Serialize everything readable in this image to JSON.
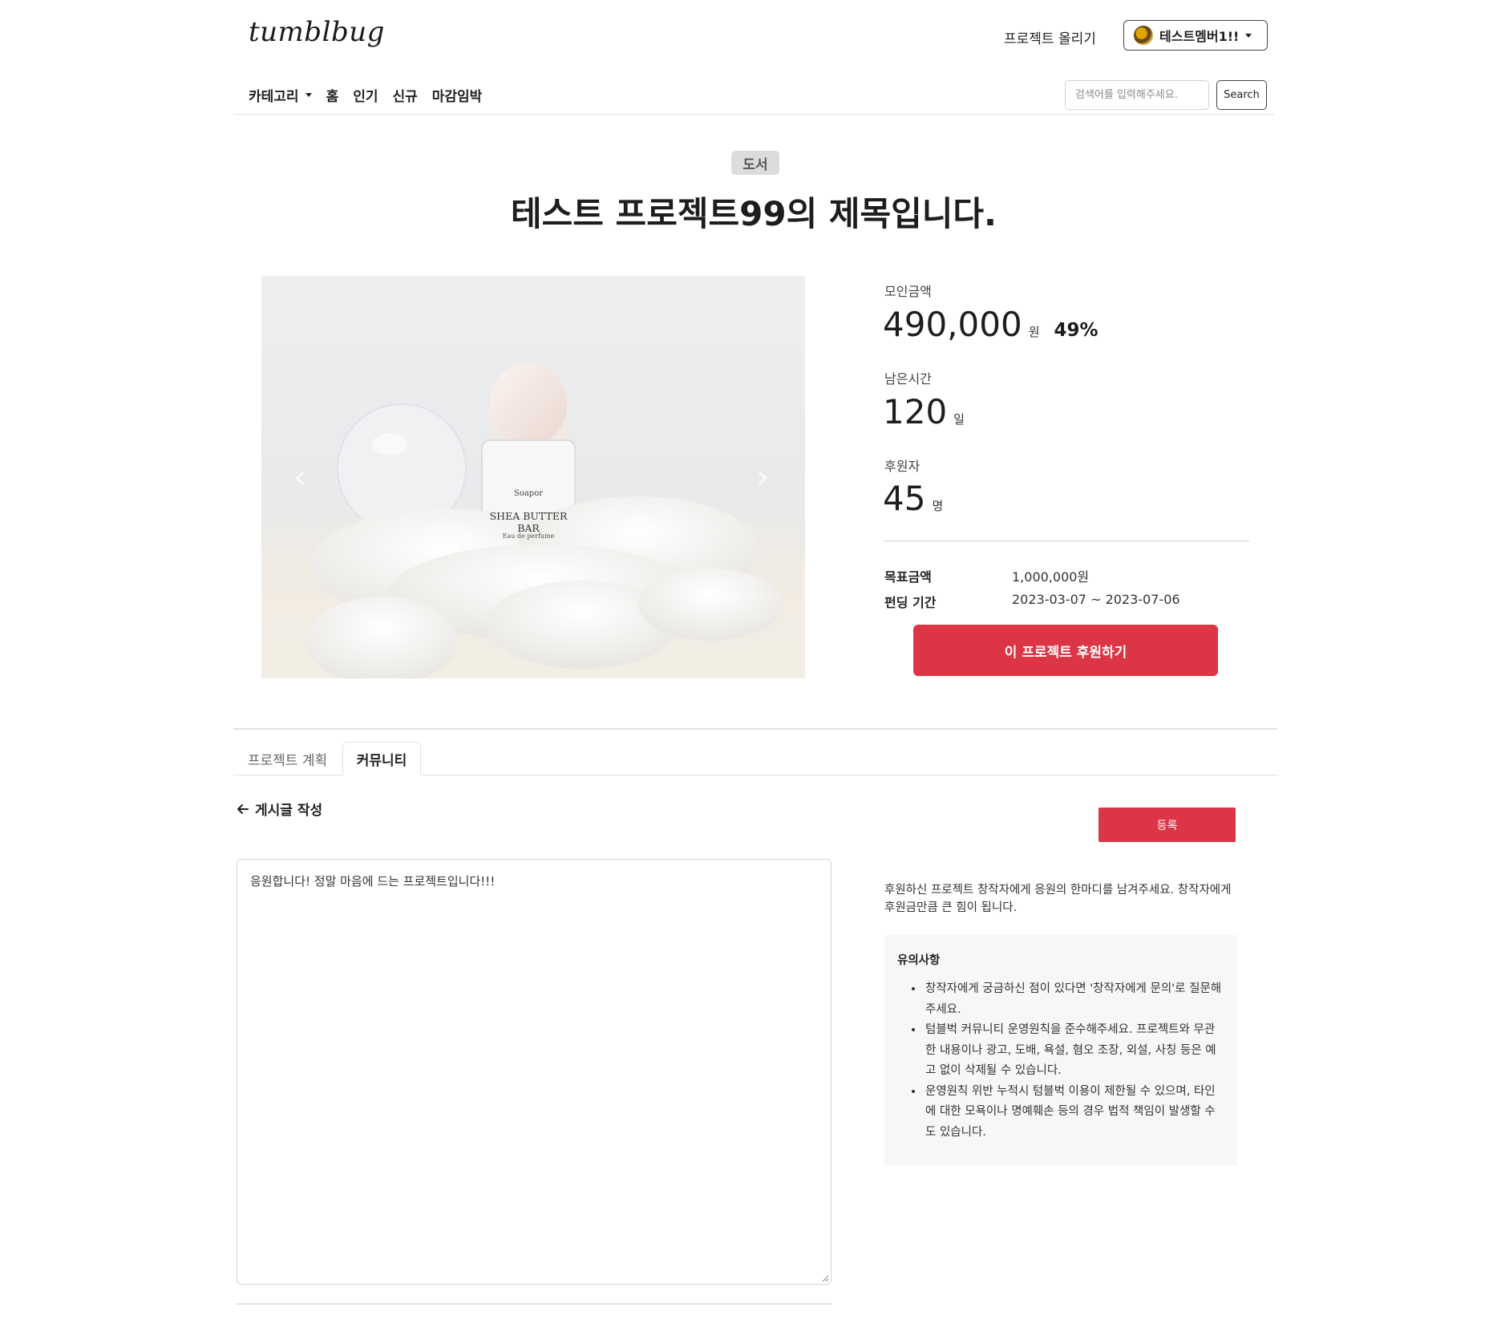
{
  "header": {
    "logo": "tumblbug",
    "upload_link": "프로젝트 올리기",
    "user_name": "테스트멤버1!!"
  },
  "nav": {
    "category": "카테고리",
    "items": [
      "홈",
      "인기",
      "신규",
      "마감임박"
    ],
    "search_placeholder": "검색어를 입력해주세요.",
    "search_button": "Search"
  },
  "project": {
    "category_badge": "도서",
    "title": "테스트 프로젝트99의 제목입니다.",
    "image": {
      "brand": "Soapor",
      "product": "SHEA BUTTER BAR",
      "sub": "Eau de perfume"
    },
    "stats": {
      "amount_label": "모인금액",
      "amount": "490,000",
      "amount_unit": "원",
      "percent": "49%",
      "time_label": "남은시간",
      "time": "120",
      "time_unit": "일",
      "backers_label": "후원자",
      "backers": "45",
      "backers_unit": "명"
    },
    "goal_label": "목표금액",
    "goal_value": "1,000,000원",
    "period_label": "펀딩 기간",
    "period_value": "2023-03-07 ~ 2023-07-06",
    "support_button": "이 프로젝트 후원하기"
  },
  "tabs": [
    {
      "label": "프로젝트 계획",
      "active": false
    },
    {
      "label": "커뮤니티",
      "active": true
    }
  ],
  "community": {
    "back_label": "게시글 작성",
    "submit_button": "등록",
    "post_text": "응원합니다! 정말 마음에 드는 프로젝트입니다!!!",
    "help_text": "후원하신 프로젝트 창작자에게 응원의 한마디를 남겨주세요. 창작자에게 후원금만큼 큰 힘이 됩니다.",
    "notice_title": "유의사항",
    "notices": [
      "창작자에게 궁금하신 점이 있다면 '창작자에게 문의'로 질문해주세요.",
      "텀블벅 커뮤니티 운영원칙을 준수해주세요. 프로젝트와 무관한 내용이나 광고, 도배, 욕설, 혐오 조장, 외설, 사칭 등은 예고 없이 삭제될 수 있습니다.",
      "운영원칙 위반 누적시 텀블벅 이용이 제한될 수 있으며, 타인에 대한 모욕이나 명예훼손 등의 경우 법적 책임이 발생할 수도 있습니다."
    ]
  },
  "colors": {
    "accent": "#dc3545",
    "notice_bg": "#f6f7f9",
    "divider": "#dee2e6"
  }
}
